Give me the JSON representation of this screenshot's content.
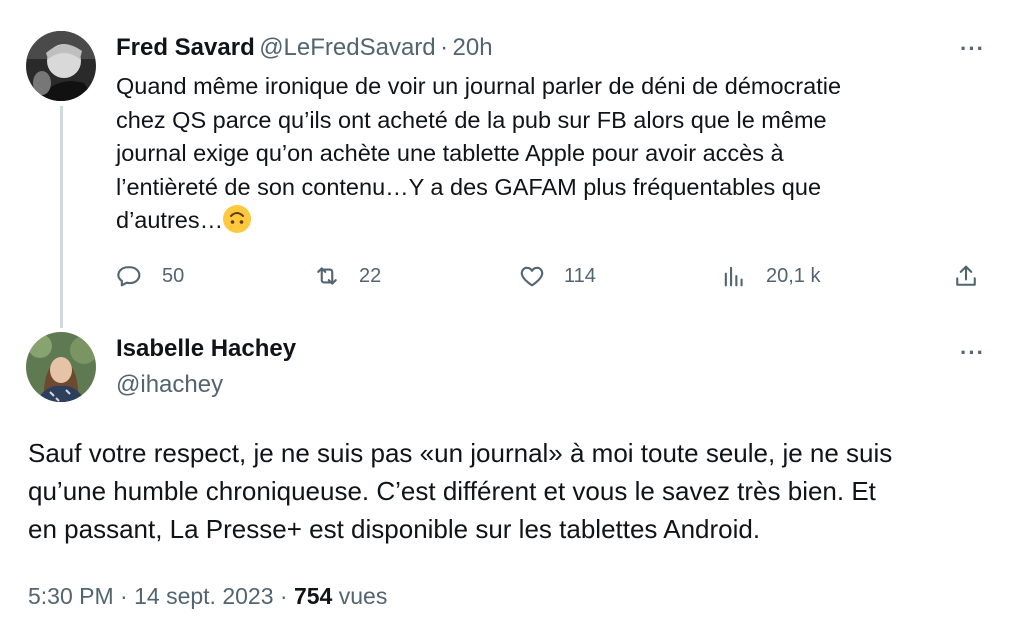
{
  "reply_to": {
    "name": "Fred Savard",
    "handle": "@LeFredSavard",
    "separator": "·",
    "time": "20h",
    "more": "···",
    "text": "Quand même ironique de voir un journal parler de déni de démocratie\nchez QS parce qu’ils ont acheté de la pub sur FB alors que le même\njournal exige qu’on achète une tablette Apple pour avoir accès à\nl’entièreté de son contenu…Y a des GAFAM plus fréquentables que\nd’autres…",
    "emoji": "upside-down-face-icon",
    "stats": {
      "replies": "50",
      "retweets": "22",
      "likes": "114",
      "views": "20,1 k"
    }
  },
  "tweet": {
    "name": "Isabelle Hachey",
    "handle": "@ihachey",
    "more": "···",
    "text": "Sauf votre respect, je ne suis pas «un journal» à moi toute seule, je ne suis\nqu’une humble chroniqueuse. C’est différent et vous le savez très bien. Et\nen passant, La Presse+ est disponible sur les tablettes Android.",
    "time": "5:30 PM",
    "dot": "·",
    "date": "14 sept. 2023",
    "views_count": "754",
    "views_label": "vues"
  },
  "colors": {
    "text": "#0f1419",
    "secondary": "#536471",
    "thread_line": "#cfd9de"
  }
}
